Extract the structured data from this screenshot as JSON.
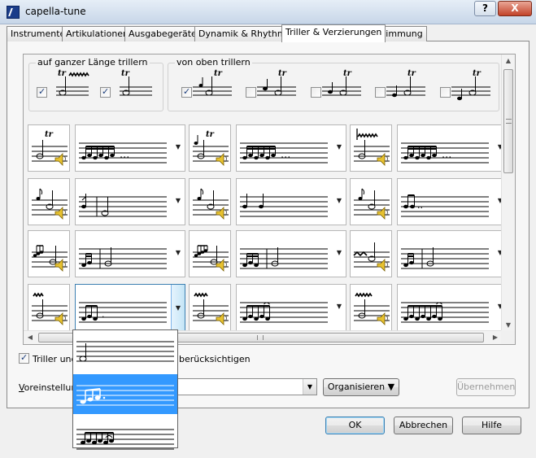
{
  "window": {
    "title": "capella-tune",
    "help_btn": "?",
    "close_btn": "X"
  },
  "tabs": [
    {
      "label": "Instrumente"
    },
    {
      "label": "Artikulationen"
    },
    {
      "label": "Ausgabegeräte"
    },
    {
      "label": "Dynamik & Rhythmik"
    },
    {
      "label": "Triller & Verzierungen",
      "active": true
    },
    {
      "label": "Stimmung"
    }
  ],
  "groups": {
    "full_length": {
      "label": "auf ganzer Länge trillern",
      "checks": [
        true,
        true
      ]
    },
    "from_above": {
      "label": "von oben trillern",
      "checks": [
        true,
        false,
        false,
        false,
        false
      ]
    }
  },
  "ornaments": {
    "trill_symbol": "tr",
    "dots": "...",
    "rows": 4,
    "cols": 3
  },
  "dropdown": {
    "items": 3,
    "selected_index": 1
  },
  "bottom": {
    "trill_check_label": "Triller und",
    "trill_check_label_tail": "berücksichtigen",
    "trill_checked": true,
    "presets_label": "Voreinstellungen",
    "organize_button": "Organisieren",
    "apply_button": "Übernehmen",
    "ok_button": "OK",
    "cancel_button": "Abbrechen",
    "help_button": "Hilfe"
  },
  "scrollbar": {
    "grip": "|||"
  }
}
